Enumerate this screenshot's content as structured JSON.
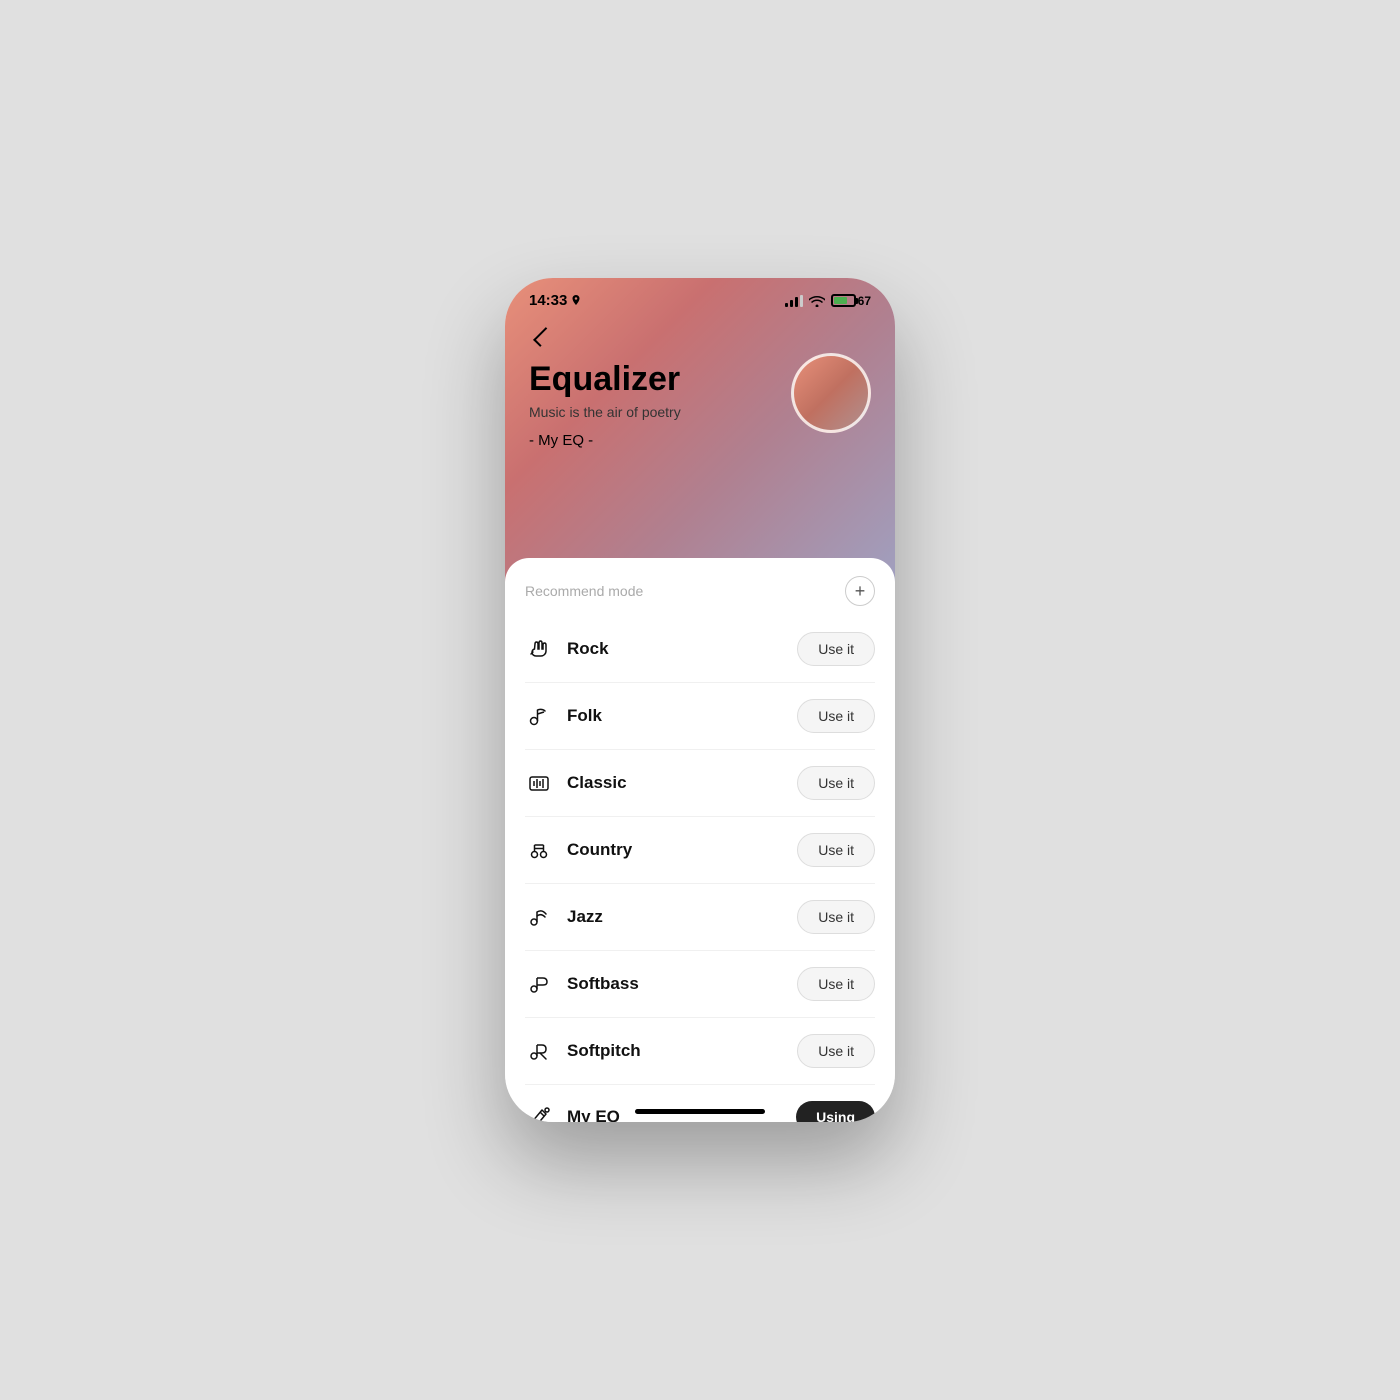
{
  "statusBar": {
    "time": "14:33",
    "battery": "67"
  },
  "header": {
    "title": "Equalizer",
    "subtitle": "Music is the air of poetry",
    "myEq": "- My EQ -"
  },
  "card": {
    "recommendLabel": "Recommend mode",
    "addButtonLabel": "+"
  },
  "eqModes": [
    {
      "id": "rock",
      "name": "Rock",
      "icon": "rock",
      "buttonLabel": "Use it",
      "active": false
    },
    {
      "id": "folk",
      "name": "Folk",
      "icon": "folk",
      "buttonLabel": "Use it",
      "active": false
    },
    {
      "id": "classic",
      "name": "Classic",
      "icon": "classic",
      "buttonLabel": "Use it",
      "active": false
    },
    {
      "id": "country",
      "name": "Country",
      "icon": "country",
      "buttonLabel": "Use it",
      "active": false
    },
    {
      "id": "jazz",
      "name": "Jazz",
      "icon": "jazz",
      "buttonLabel": "Use it",
      "active": false
    },
    {
      "id": "softbass",
      "name": "Softbass",
      "icon": "softbass",
      "buttonLabel": "Use it",
      "active": false
    },
    {
      "id": "softpitch",
      "name": "Softpitch",
      "icon": "softpitch",
      "buttonLabel": "Use it",
      "active": false
    },
    {
      "id": "myeq",
      "name": "My EQ",
      "icon": "myeq",
      "buttonLabel": "Using",
      "active": true
    }
  ]
}
